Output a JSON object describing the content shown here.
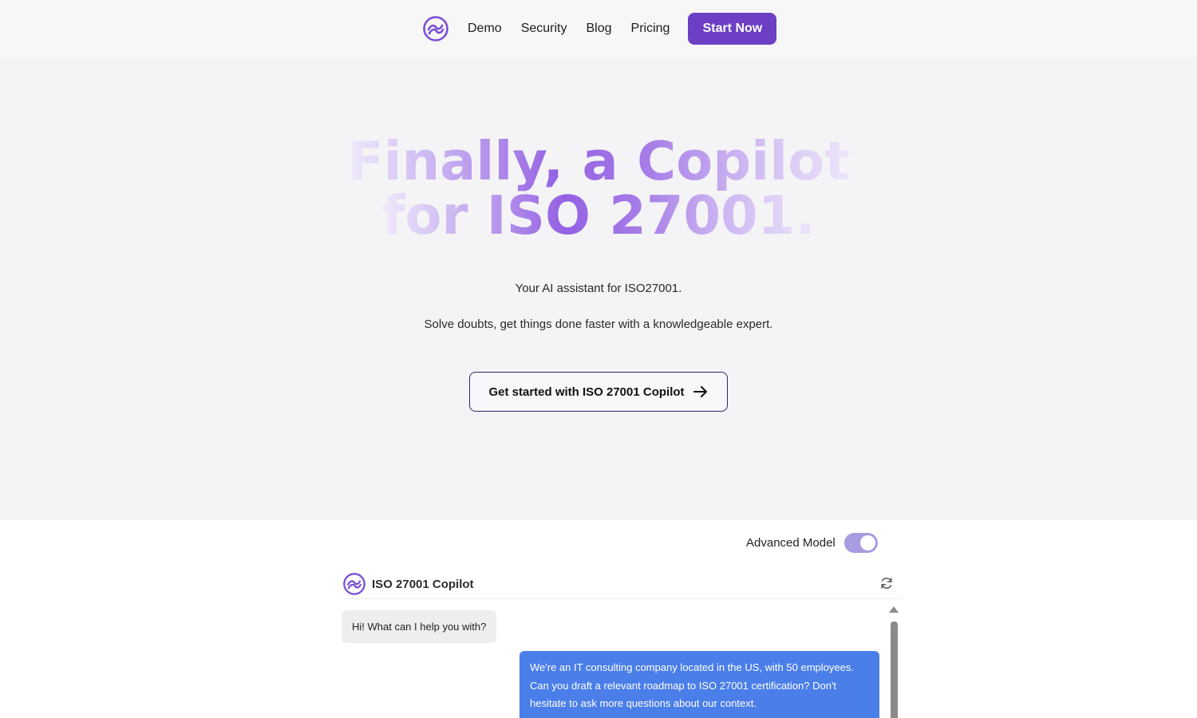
{
  "nav": {
    "logo_icon": "copilot-logo-icon",
    "links": [
      "Demo",
      "Security",
      "Blog",
      "Pricing"
    ],
    "start_label": "Start Now",
    "accent": "#6c3fc4"
  },
  "hero": {
    "headline_line1": "Finally, a Copilot",
    "headline_line2": "for ISO 27001.",
    "subtitle1": "Your AI assistant for ISO27001.",
    "subtitle2": "Solve doubts, get things done faster with a knowledgeable expert.",
    "cta_label": "Get started with ISO 27001 Copilot",
    "cta_icon": "arrow-right-icon"
  },
  "demo": {
    "advanced_label": "Advanced Model",
    "advanced_on": true,
    "chat_title": "ISO 27001 Copilot",
    "refresh_icon": "refresh-icon",
    "messages": [
      {
        "role": "bot",
        "text": "Hi! What can I help you with?"
      },
      {
        "role": "user",
        "text": "We're an IT consulting company located in the US, with 50 employees. Can you draft a relevant roadmap to ISO 27001 certification? Don't hesitate to ask more questions about our context."
      }
    ],
    "user_bubble_color": "#4a7ee9"
  }
}
